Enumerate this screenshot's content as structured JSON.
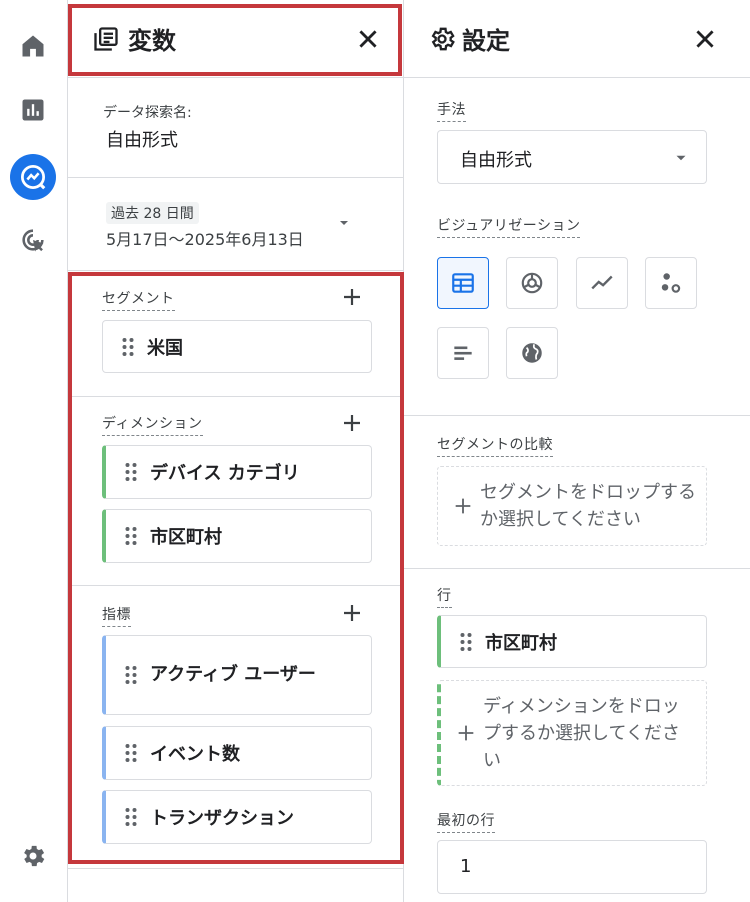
{
  "variables_panel": {
    "title": "変数",
    "exploration_name_label": "データ探索名:",
    "exploration_name": "自由形式",
    "date_range_badge": "過去 28 日間",
    "date_range": "5月17日～2025年6月13日",
    "segments": {
      "label": "セグメント",
      "items": [
        "米国"
      ]
    },
    "dimensions": {
      "label": "ディメンション",
      "items": [
        "デバイス カテゴリ",
        "市区町村"
      ]
    },
    "metrics": {
      "label": "指標",
      "items": [
        "アクティブ ユーザー",
        "イベント数",
        "トランザクション"
      ]
    }
  },
  "settings_panel": {
    "title": "設定",
    "technique_label": "手法",
    "technique_value": "自由形式",
    "visualization_label": "ビジュアリゼーション",
    "visualizations": [
      "table-icon",
      "donut-chart-icon",
      "line-chart-icon",
      "scatter-icon",
      "bar-chart-icon",
      "globe-icon"
    ],
    "segment_compare_label": "セグメントの比較",
    "segment_drop_text": "セグメントをドロップするか選択してください",
    "rows_label": "行",
    "rows_items": [
      "市区町村"
    ],
    "rows_drop_text": "ディメンションをドロップするか選択してください",
    "first_row_label": "最初の行",
    "first_row_value": "1"
  },
  "colors": {
    "accent": "#1a73e8",
    "dimension_color": "#6dbf7b",
    "metric_color": "#8ab4f0",
    "highlight": "#c5383c"
  }
}
